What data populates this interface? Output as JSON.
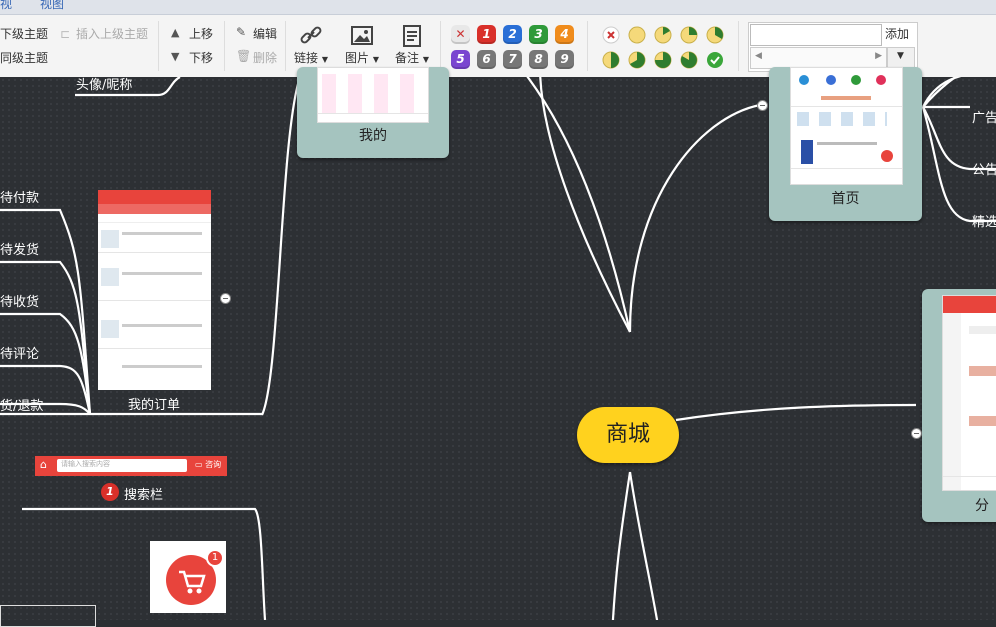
{
  "menu": {
    "tabs": [
      "视",
      "视图"
    ]
  },
  "toolbar": {
    "insert_child": "下级主题",
    "insert_sibling": "同级主题",
    "insert_parent": "插入上级主题",
    "move_up": "上移",
    "move_down": "下移",
    "edit": "编辑",
    "delete": "删除",
    "link": "链接",
    "image": "图片",
    "note": "备注",
    "priorities": [
      "1",
      "2",
      "3",
      "4",
      "5",
      "6",
      "7",
      "8",
      "9"
    ],
    "add_label": "添加"
  },
  "colors": {
    "central": "#ffd21e",
    "card": "#a5c4bf",
    "canvas": "#2d3034",
    "priority_red": "#d9302a"
  },
  "mindmap": {
    "central": "商城",
    "left_labels": [
      "头像/昵称",
      "待付款",
      "待发货",
      "待收货",
      "待评论",
      "货/退款"
    ],
    "cards": {
      "my": "我的",
      "orders": "我的订单",
      "home": "首页",
      "category": "分"
    },
    "search_badge": "1",
    "search_label": "搜索栏",
    "search_placeholder": "请输入搜索内容",
    "right_labels": [
      "广告",
      "公告",
      "精选"
    ],
    "cart_badge": "1"
  }
}
